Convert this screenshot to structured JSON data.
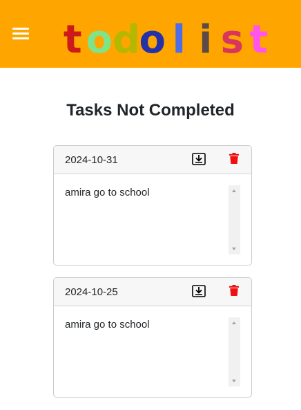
{
  "app": {
    "logo_letters": [
      {
        "char": "t",
        "color": "#cc1a1a"
      },
      {
        "char": "o",
        "color": "#7fe38a"
      },
      {
        "char": "d",
        "color": "#b5b800"
      },
      {
        "char": "o",
        "color": "#2431a8"
      },
      {
        "char": "l",
        "color": "#4d6ee8"
      },
      {
        "char": "i",
        "color": "#5c4a4a"
      },
      {
        "char": "s",
        "color": "#d8365c"
      },
      {
        "char": "t",
        "color": "#ff55ee"
      }
    ],
    "navbar_color": "#ffa500",
    "menu_icon": "hamburger-icon"
  },
  "main": {
    "title": "Tasks Not Completed"
  },
  "tasks": [
    {
      "date": "2024-10-31",
      "text": "amira go to school",
      "save_icon": "download-icon",
      "delete_icon": "trash-icon"
    },
    {
      "date": "2024-10-25",
      "text": "amira go to school",
      "save_icon": "download-icon",
      "delete_icon": "trash-icon"
    }
  ],
  "colors": {
    "delete": "#ee1111",
    "save": "#000000"
  }
}
